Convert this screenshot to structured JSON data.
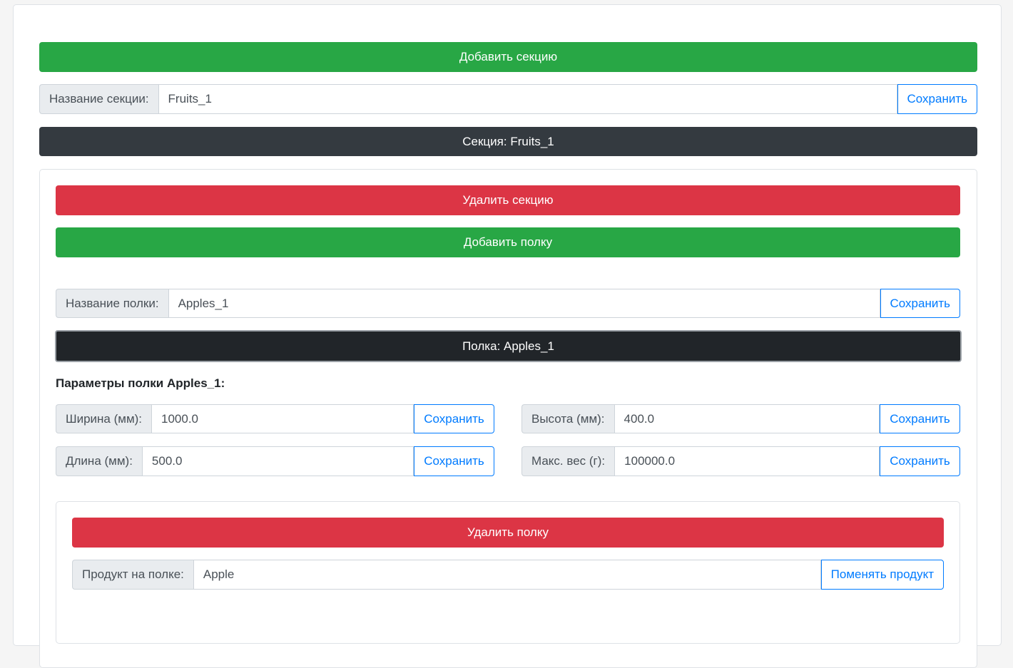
{
  "add_section_label": "Добавить секцию",
  "section_name": {
    "label": "Название секции:",
    "value": "Fruits_1",
    "save": "Сохранить"
  },
  "section_header": "Секция: Fruits_1",
  "section": {
    "delete_label": "Удалить секцию",
    "add_shelf_label": "Добавить полку",
    "shelf_name": {
      "label": "Название полки:",
      "value": "Apples_1",
      "save": "Сохранить"
    },
    "shelf_header": "Полка: Apples_1",
    "params_heading": "Параметры полки Apples_1:",
    "params": {
      "width": {
        "label": "Ширина (мм):",
        "value": "1000.0",
        "save": "Сохранить"
      },
      "height": {
        "label": "Высота (мм):",
        "value": "400.0",
        "save": "Сохранить"
      },
      "length": {
        "label": "Длина (мм):",
        "value": "500.0",
        "save": "Сохранить"
      },
      "max_weight": {
        "label": "Макс. вес (г):",
        "value": "100000.0",
        "save": "Сохранить"
      }
    },
    "shelf": {
      "delete_label": "Удалить полку",
      "product": {
        "label": "Продукт на полке:",
        "value": "Apple",
        "change": "Поменять продукт"
      }
    }
  }
}
